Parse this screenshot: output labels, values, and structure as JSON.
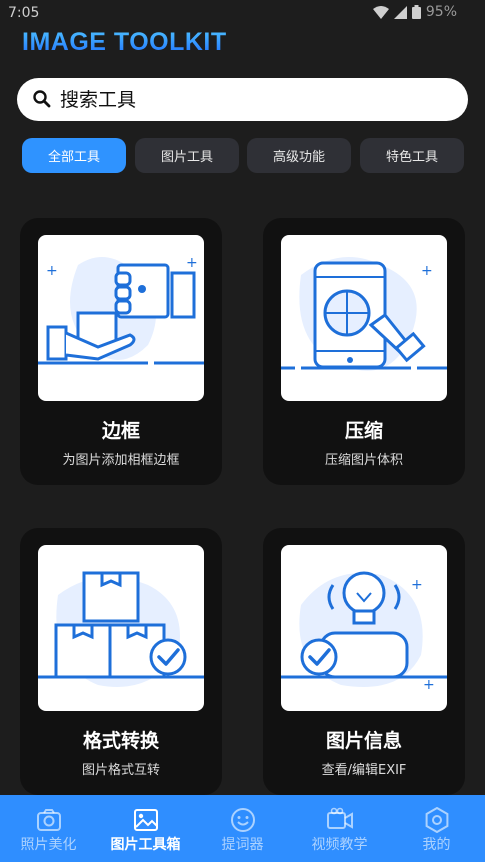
{
  "status": {
    "time": "7:05",
    "battery": "95%"
  },
  "app": {
    "title": "IMAGE TOOLKIT"
  },
  "search": {
    "placeholder": "搜索工具"
  },
  "tabs": [
    {
      "label": "全部工具",
      "active": true
    },
    {
      "label": "图片工具",
      "active": false
    },
    {
      "label": "高级功能",
      "active": false
    },
    {
      "label": "特色工具",
      "active": false
    }
  ],
  "tools": [
    {
      "title": "边框",
      "desc": "为图片添加相框边框"
    },
    {
      "title": "压缩",
      "desc": "压缩图片体积"
    },
    {
      "title": "格式转换",
      "desc": "图片格式互转"
    },
    {
      "title": "图片信息",
      "desc": "查看/编辑EXIF"
    }
  ],
  "nav": [
    {
      "label": "照片美化",
      "icon": "camera-icon",
      "active": false
    },
    {
      "label": "图片工具箱",
      "icon": "image-icon",
      "active": true
    },
    {
      "label": "提词器",
      "icon": "smile-icon",
      "active": false
    },
    {
      "label": "视频教学",
      "icon": "video-icon",
      "active": false
    },
    {
      "label": "我的",
      "icon": "profile-icon",
      "active": false
    }
  ],
  "colors": {
    "accent": "#2f8eff",
    "background": "#1d1d1d",
    "card": "#111111",
    "illustration": "#1e6fd9"
  }
}
